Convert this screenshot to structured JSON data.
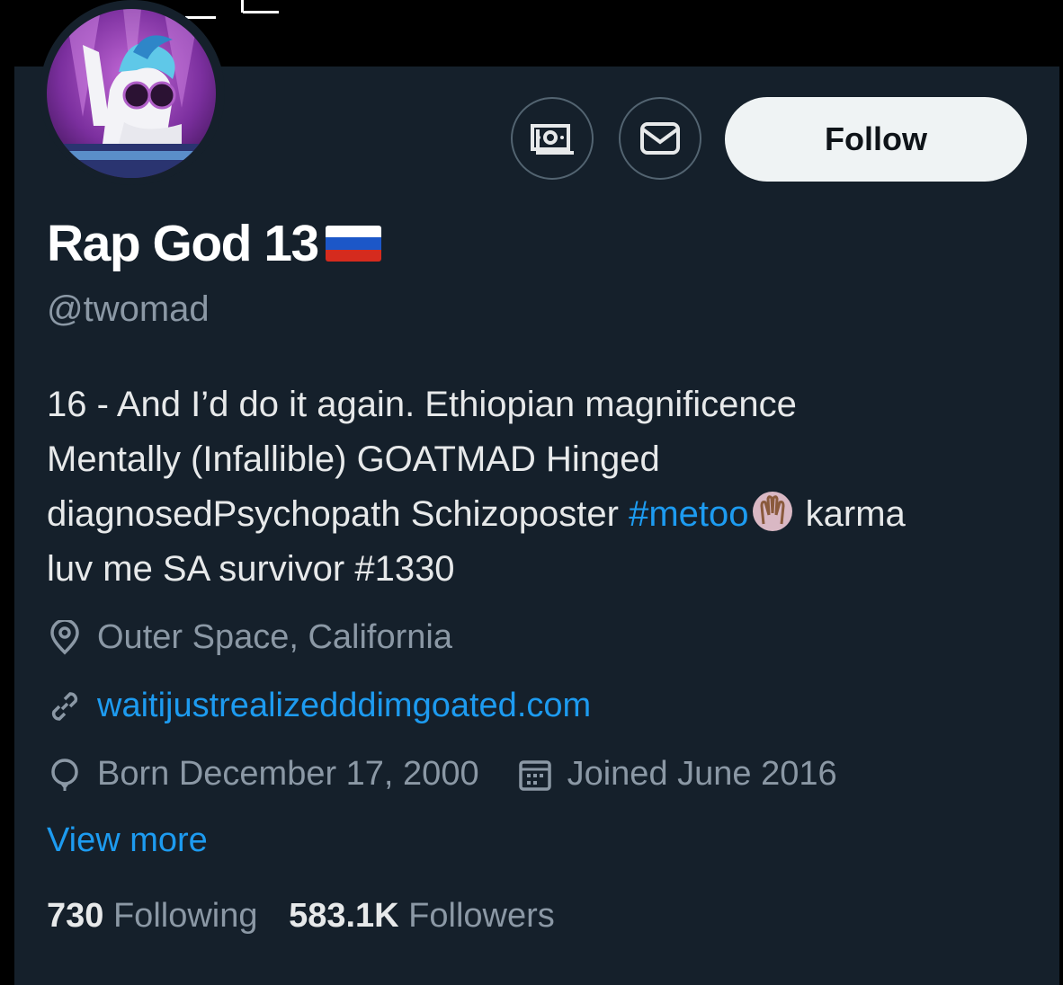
{
  "profile": {
    "display_name": "Rap God 13",
    "handle": "@twomad",
    "bio": {
      "line1": "16 - And I’d do it again. Ethiopian magnificence",
      "line2": "Mentally (Infallible) GOATMAD Hinged",
      "line3_before": "diagnosedPsychopath Schizoposter ",
      "line3_hashtag": "#metoo",
      "line3_after": " karma",
      "line4": "luv me SA survivor #1330"
    },
    "location": "Outer Space, California",
    "website": "waitijustrealizedddimgoated.com",
    "birthday": "Born December 17, 2000",
    "joined": "Joined June 2016",
    "view_more": "View more",
    "following_count": "730",
    "following_label": "Following",
    "followers_count": "583.1K",
    "followers_label": "Followers"
  },
  "actions": {
    "follow_label": "Follow",
    "money_icon": "money-icon",
    "message_icon": "envelope-icon"
  },
  "colors": {
    "background": "#15202b",
    "accent": "#1d9bf0",
    "secondary_text": "#8b98a5"
  }
}
